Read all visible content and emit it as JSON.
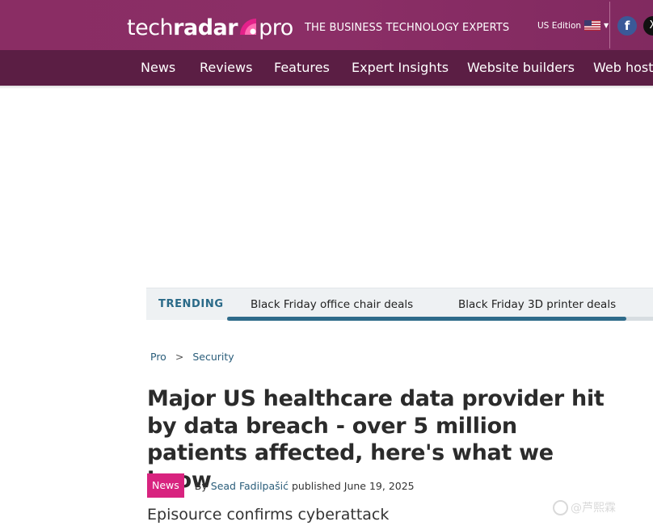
{
  "brand": {
    "logo_tech": "tech",
    "logo_radar": "radar",
    "logo_pro": "pro",
    "tagline": "THE BUSINESS TECHNOLOGY EXPERTS",
    "edition": "US Edition",
    "facebook_glyph": "f",
    "x_glyph": "X"
  },
  "nav": {
    "items": [
      "News",
      "Reviews",
      "Features",
      "Expert Insights",
      "Website builders",
      "Web hosti"
    ]
  },
  "trending": {
    "label": "TRENDING",
    "items": [
      "Black Friday office chair deals",
      "Black Friday 3D printer deals"
    ]
  },
  "breadcrumb": {
    "items": [
      "Pro",
      "Security"
    ],
    "separator": ">"
  },
  "article": {
    "headline": "Major US healthcare data provider hit by data breach - over 5 million patients affected, here's what we know",
    "category_badge": "News",
    "by": "By",
    "author": "Sead Fadilpašić",
    "published": "published June 19, 2025",
    "strapline": "Episource confirms cyberattack"
  },
  "watermark": {
    "text": "@芦熙霖"
  },
  "colors": {
    "header_bg": "#8a2d64",
    "nav_bg": "#5b1e44",
    "accent_pink": "#d8237f",
    "link_blue": "#2a5d7a",
    "trending_blue": "#2e6b8a"
  },
  "icons": [
    "us-flag-icon",
    "chevron-down-icon",
    "facebook-icon",
    "x-icon",
    "radar-logo-mark-icon"
  ]
}
